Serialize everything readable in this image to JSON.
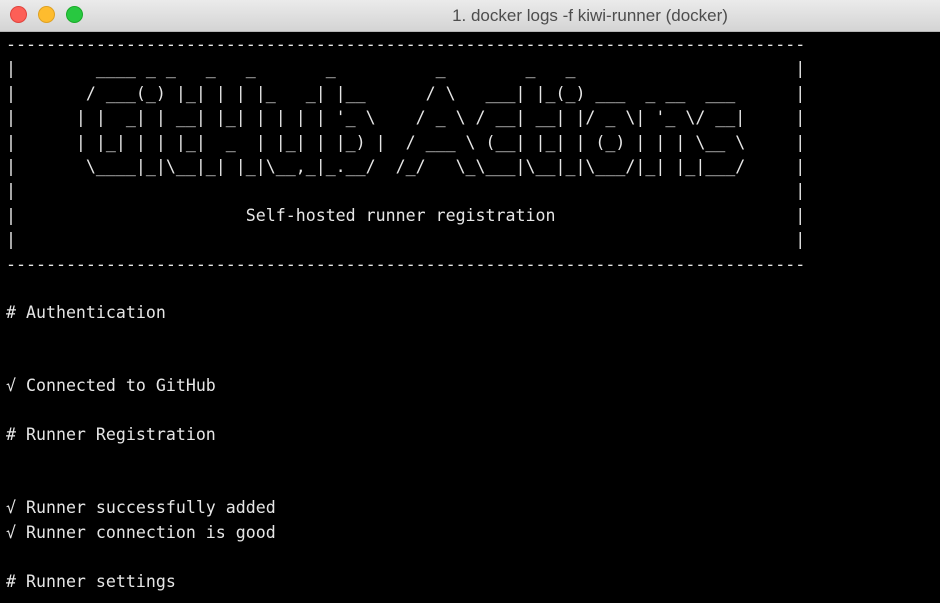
{
  "window": {
    "title": "1. docker logs -f kiwi-runner (docker)"
  },
  "terminal": {
    "lines": [
      "--------------------------------------------------------------------------------",
      "|        ____ _ _   _   _       _          _        _   _                      |",
      "|       / ___(_) |_| | | |_   _| |__      / \\   ___| |_(_) ___  _ __  ___      |",
      "|      | |  _| | __| |_| | | | | '_ \\    / _ \\ / __| __| |/ _ \\| '_ \\/ __|     |",
      "|      | |_| | | |_|  _  | |_| | |_) |  / ___ \\ (__| |_| | (_) | | | \\__ \\     |",
      "|       \\____|_|\\__|_| |_|\\__,_|_.__/  /_/   \\_\\___|\\__|_|\\___/|_| |_|___/     |",
      "|                                                                              |",
      "|                       Self-hosted runner registration                        |",
      "|                                                                              |",
      "--------------------------------------------------------------------------------",
      "",
      "# Authentication",
      "",
      "",
      "√ Connected to GitHub",
      "",
      "# Runner Registration",
      "",
      "",
      "√ Runner successfully added",
      "√ Runner connection is good",
      "",
      "# Runner settings"
    ]
  }
}
